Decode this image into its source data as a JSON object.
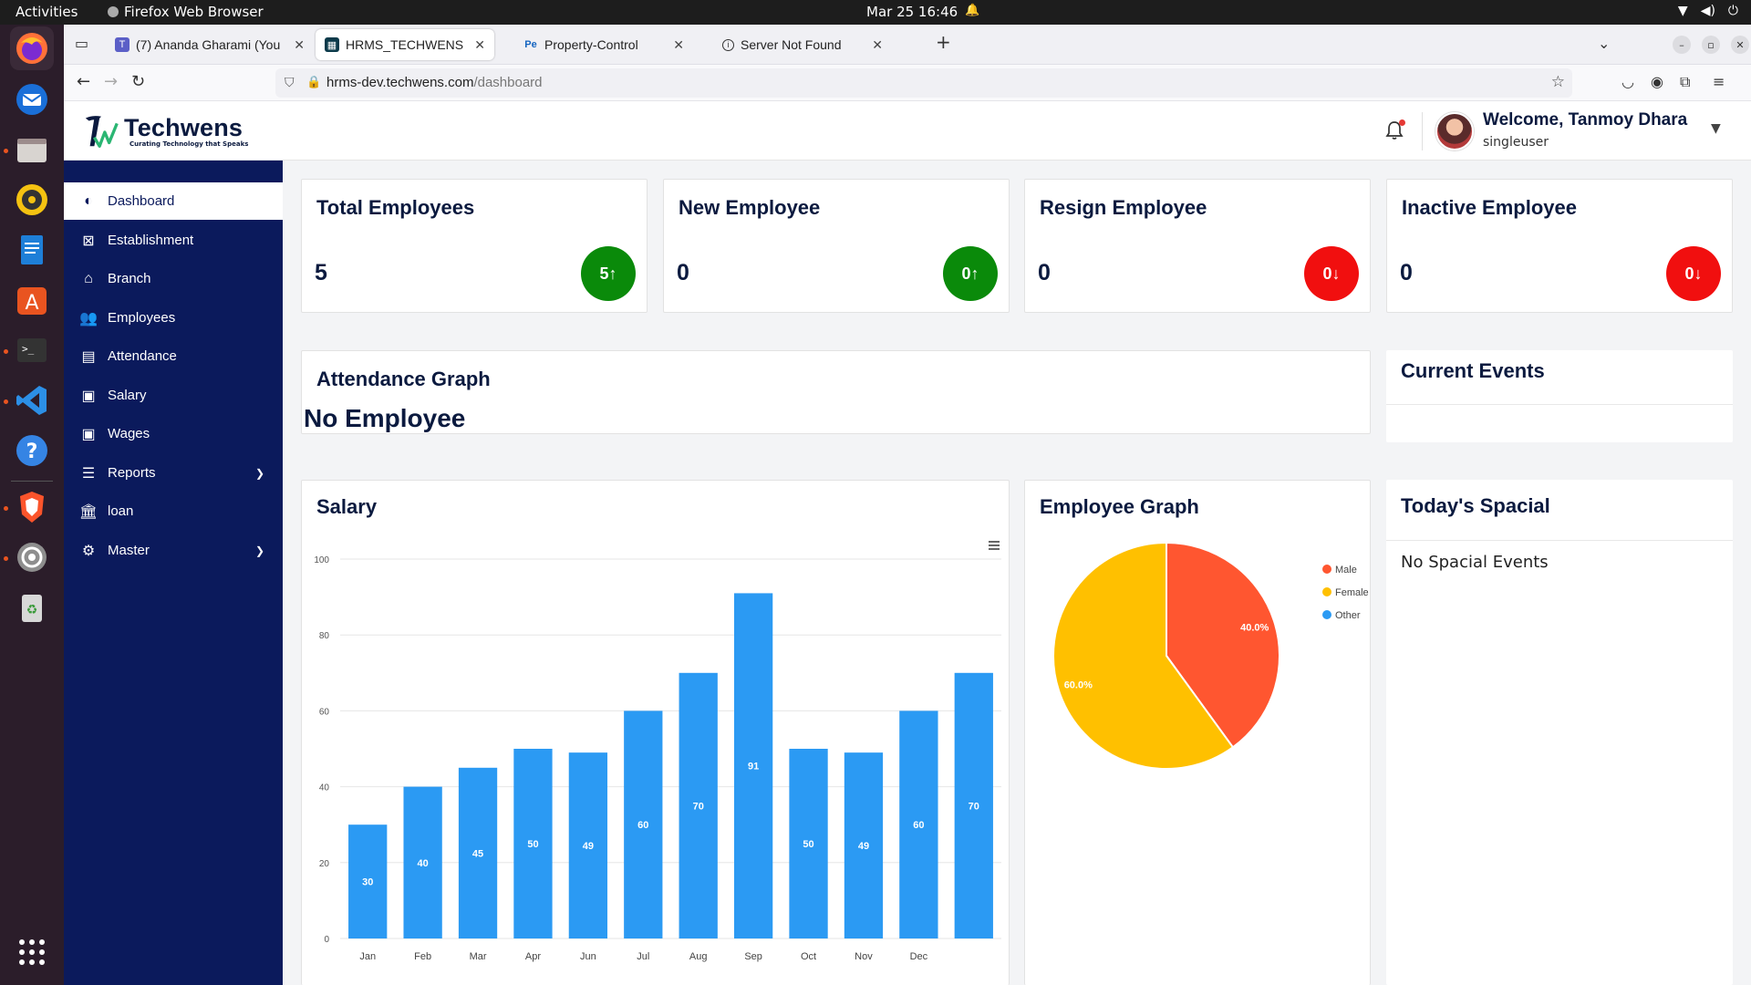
{
  "os": {
    "activities": "Activities",
    "app_name": "Firefox Web Browser",
    "clock": "Mar 25  16:46"
  },
  "browser": {
    "tabs": [
      {
        "title": "(7) Ananda Gharami (You",
        "icon": "teams-icon",
        "active": false
      },
      {
        "title": "HRMS_TECHWENS",
        "icon": "hrms-icon",
        "active": true
      },
      {
        "title": "Property-Control",
        "icon": "pe-icon",
        "active": false
      },
      {
        "title": "Server Not Found",
        "icon": "info-icon",
        "active": false
      }
    ],
    "url_host": "hrms-dev.techwens.com",
    "url_path": "/dashboard"
  },
  "header": {
    "brand_name": "Techwens",
    "brand_tagline": "Curating Technology that Speaks",
    "welcome": "Welcome, Tanmoy Dhara",
    "role": "singleuser"
  },
  "sidebar": {
    "items": [
      {
        "label": "Dashboard",
        "icon": "palette-icon",
        "active": true
      },
      {
        "label": "Establishment",
        "icon": "ticket-icon"
      },
      {
        "label": "Branch",
        "icon": "building-icon"
      },
      {
        "label": "Employees",
        "icon": "group-icon"
      },
      {
        "label": "Attendance",
        "icon": "calendar-icon"
      },
      {
        "label": "Salary",
        "icon": "wallet-icon"
      },
      {
        "label": "Wages",
        "icon": "wallet-icon"
      },
      {
        "label": "Reports",
        "icon": "report-icon",
        "expandable": true
      },
      {
        "label": "loan",
        "icon": "bank-icon"
      },
      {
        "label": "Master",
        "icon": "master-icon",
        "expandable": true
      }
    ]
  },
  "stats": [
    {
      "title": "Total Employees",
      "value": "5",
      "badge": "5↑",
      "color": "#0a8a0a"
    },
    {
      "title": "New Employee",
      "value": "0",
      "badge": "0↑",
      "color": "#0a8a0a"
    },
    {
      "title": "Resign Employee",
      "value": "0",
      "badge": "0↓",
      "color": "#f10f0f"
    },
    {
      "title": "Inactive Employee",
      "value": "0",
      "badge": "0↓",
      "color": "#f10f0f"
    }
  ],
  "attendance": {
    "title": "Attendance Graph",
    "empty": "No Employee"
  },
  "events": {
    "title": "Current Events"
  },
  "salary": {
    "title": "Salary"
  },
  "employee_graph": {
    "title": "Employee Graph"
  },
  "special": {
    "title": "Today's Spacial",
    "empty": "No Spacial Events"
  },
  "chart_data": [
    {
      "type": "bar",
      "title": "Salary",
      "categories": [
        "Jan",
        "Feb",
        "Mar",
        "Apr",
        "Jun",
        "Jul",
        "Aug",
        "Sep",
        "Oct",
        "Nov",
        "Dec",
        ""
      ],
      "values": [
        30,
        40,
        45,
        50,
        49,
        60,
        70,
        91,
        50,
        49,
        60,
        70
      ],
      "ylim": [
        0,
        100
      ],
      "yticks": [
        0,
        20,
        40,
        60,
        80,
        100
      ],
      "color": "#2b9af3",
      "grid": true
    },
    {
      "type": "pie",
      "title": "Employee Graph",
      "labels": [
        "Male",
        "Female",
        "Other"
      ],
      "values": [
        40.0,
        60.0,
        0
      ],
      "colors": [
        "#ff5630",
        "#ffc000",
        "#2b9af3"
      ],
      "legend": "right"
    }
  ]
}
